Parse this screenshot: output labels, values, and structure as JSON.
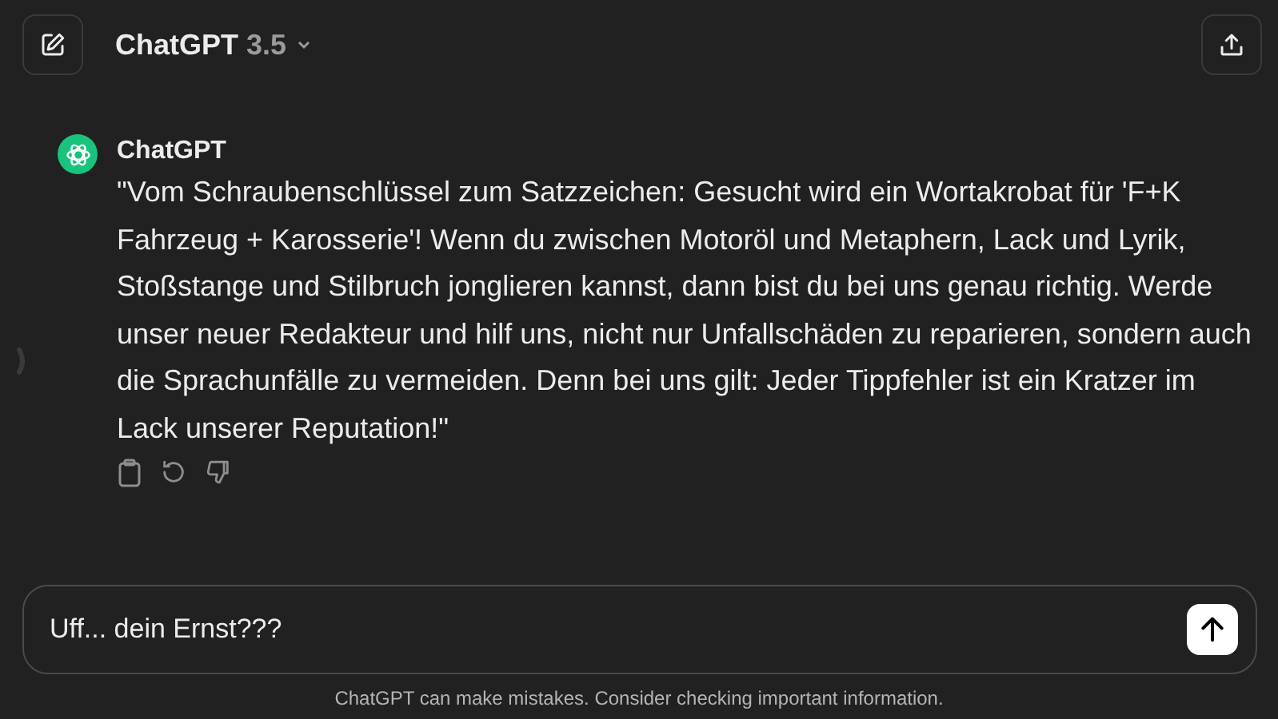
{
  "header": {
    "model_name": "ChatGPT",
    "model_version": "3.5"
  },
  "messages": [
    {
      "author": "ChatGPT",
      "text": "\"Vom Schraubenschlüssel zum Satzzeichen: Gesucht wird ein Wortakrobat für 'F+K Fahrzeug + Karosserie'! Wenn du zwischen Motoröl und Metaphern, Lack und Lyrik, Stoßstange und Stilbruch jonglieren kannst, dann bist du bei uns genau richtig. Werde unser neuer Redakteur und hilf uns, nicht nur Unfallschäden zu reparieren, sondern auch die Sprachunfälle zu vermeiden. Denn bei uns gilt: Jeder Tippfehler ist ein Kratzer im Lack unserer Reputation!\""
    }
  ],
  "composer": {
    "value": "Uff... dein Ernst???"
  },
  "footer_note": "ChatGPT can make mistakes. Consider checking important information."
}
